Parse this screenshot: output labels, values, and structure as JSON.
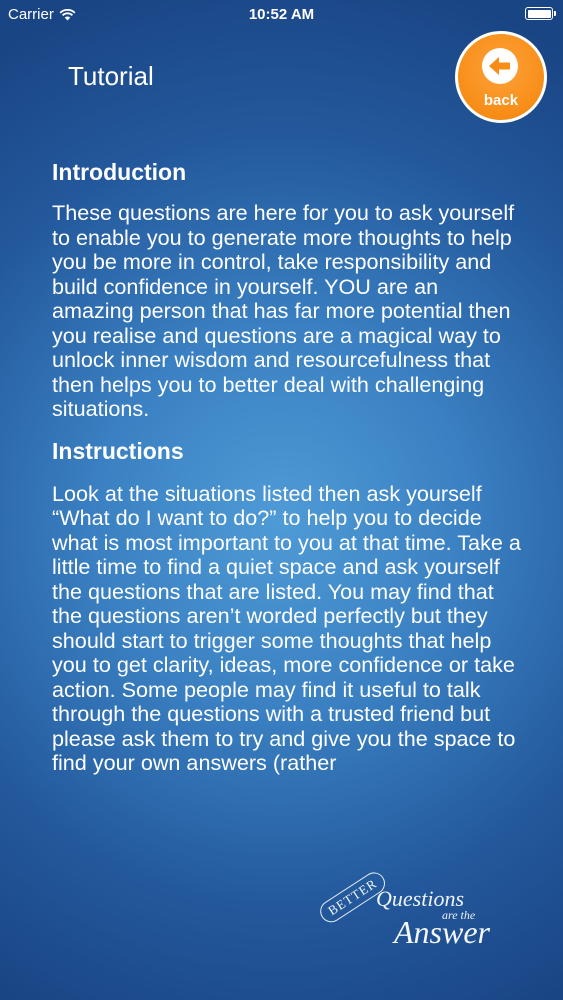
{
  "status_bar": {
    "carrier": "Carrier",
    "time": "10:52 AM"
  },
  "header": {
    "title": "Tutorial",
    "back_label": "back"
  },
  "sections": [
    {
      "heading": "Introduction",
      "body": "These questions are here for you to ask yourself to enable you to generate more thoughts to help you be more in control, take responsibility and build confidence in yourself. YOU are an amazing person that has far more potential then you realise and questions are a magical way to unlock inner wisdom and resourcefulness that then helps you to better deal with challenging situations."
    },
    {
      "heading": "Instructions",
      "body": "Look at the situations listed then ask yourself “What do I want to do?” to help you to decide what is most important to you at that time. Take a little time to find a quiet space and ask yourself the questions that are listed. You may find that the questions aren’t worded perfectly but they should start to trigger some thoughts that help you to get clarity, ideas, more confidence or take action. Some people may find it useful to talk through the questions with a trusted friend but please ask them to try and give you the space to find your own answers (rather"
    }
  ],
  "logo": {
    "better": "BETTER",
    "questions": "Questions",
    "are_the": "are the",
    "answer": "Answer"
  },
  "colors": {
    "background_top": "#1a4585",
    "background_center": "#4f9bd6",
    "back_button": "#f78d17",
    "text": "#ffffff"
  }
}
